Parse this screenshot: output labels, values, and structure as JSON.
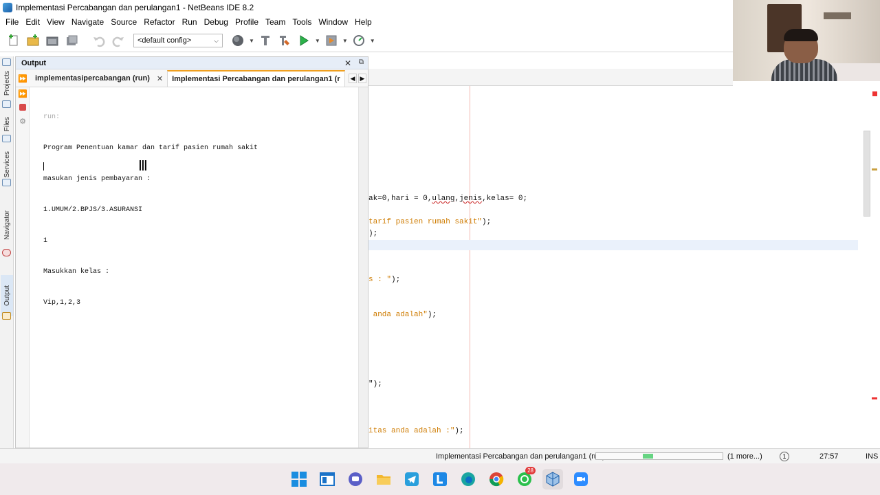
{
  "window": {
    "title": "Implementasi Percabangan dan perulangan1 - NetBeans IDE 8.2"
  },
  "menu": [
    "File",
    "Edit",
    "View",
    "Navigate",
    "Source",
    "Refactor",
    "Run",
    "Debug",
    "Profile",
    "Team",
    "Tools",
    "Window",
    "Help"
  ],
  "toolbar": {
    "config": "<default config>",
    "icons": [
      "new-file-icon",
      "new-project-icon",
      "open-project-icon",
      "save-all-icon",
      "undo-icon",
      "redo-icon",
      "browser-globe-icon",
      "clean-build-icon",
      "build-icon",
      "run-icon",
      "debug-icon",
      "profile-icon"
    ]
  },
  "side_tabs": [
    "Projects",
    "Files",
    "Services",
    "Navigator",
    "Output"
  ],
  "output": {
    "title": "Output",
    "tabs": [
      {
        "label": "implementasipercabangan (run)",
        "active": false
      },
      {
        "label": "Implementasi Percabangan dan perulangan1 (r",
        "active": true
      }
    ],
    "lines": [
      "run:",
      "Program Penentuan kamar dan tarif pasien rumah sakit",
      "masukan jenis pembayaran :",
      "1.UMUM/2.BPJS/3.ASURANSI",
      "1",
      "Masukkan kelas :",
      "Vip,1,2,3"
    ]
  },
  "editor": {
    "lines": [
      {
        "pre": "ak=0,hari = 0,",
        "und": "ulang",
        "mid": ",",
        "und2": "jenis",
        "post": ",kelas= 0;",
        "str": ""
      },
      {
        "str": "tarif pasien rumah sakit\"",
        "post": ");"
      },
      {
        "post": ");"
      },
      {
        "str": "s : \"",
        "post": ");"
      },
      {
        "str": " anda adalah\"",
        "post": ");"
      },
      {
        "post": "\");"
      },
      {
        "str": "itas anda adalah :\"",
        "post": ");"
      }
    ]
  },
  "status": {
    "task": "Implementasi Percabangan dan perulangan1 (run)",
    "more": "(1 more...)",
    "notifications": "1",
    "position": "27:57",
    "mode": "INS",
    "progress_fraction": 0.08
  },
  "taskbar": {
    "apps": [
      "windows-start-icon",
      "file-explorer-window-icon",
      "teams-chat-icon",
      "folder-icon",
      "telegram-icon",
      "lms-l-icon",
      "edge-icon",
      "chrome-icon",
      "whatsapp-icon",
      "netbeans-icon",
      "zoom-icon"
    ],
    "whatsapp_badge": "28"
  },
  "colors": {
    "string": "#ce7b00",
    "accent_tab": "#f0a020",
    "error": "#e33333"
  }
}
